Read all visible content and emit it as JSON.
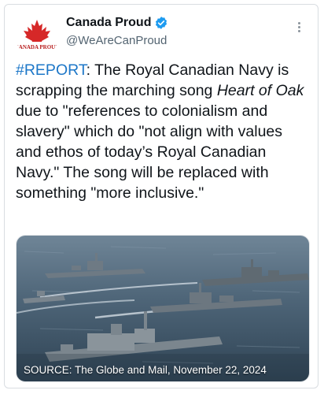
{
  "tweet": {
    "author_name": "Canada Proud",
    "author_handle": "@WeAreCanProud",
    "avatar_text": "CANADA PROUD",
    "text_tag": "#REPORT",
    "text_lead": ": The Royal Canadian Navy is scrapping the marching song ",
    "text_italic": "Heart of Oak",
    "text_rest": " due to \"references to colonialism and slavery\" which do \"not align with values and ethos of today’s Royal Canadian Navy.\" The song will be replaced with something \"more inclusive.\"",
    "media_caption": "SOURCE: The Globe and Mail, November 22, 2024"
  },
  "colors": {
    "hashtag": "#1d77c8",
    "verified_badge": "#1d9bf0",
    "maple_leaf": "#d62828"
  },
  "icons": {
    "verified": "verified-badge-icon",
    "more": "more-options-icon",
    "avatar": "maple-leaf-icon"
  }
}
